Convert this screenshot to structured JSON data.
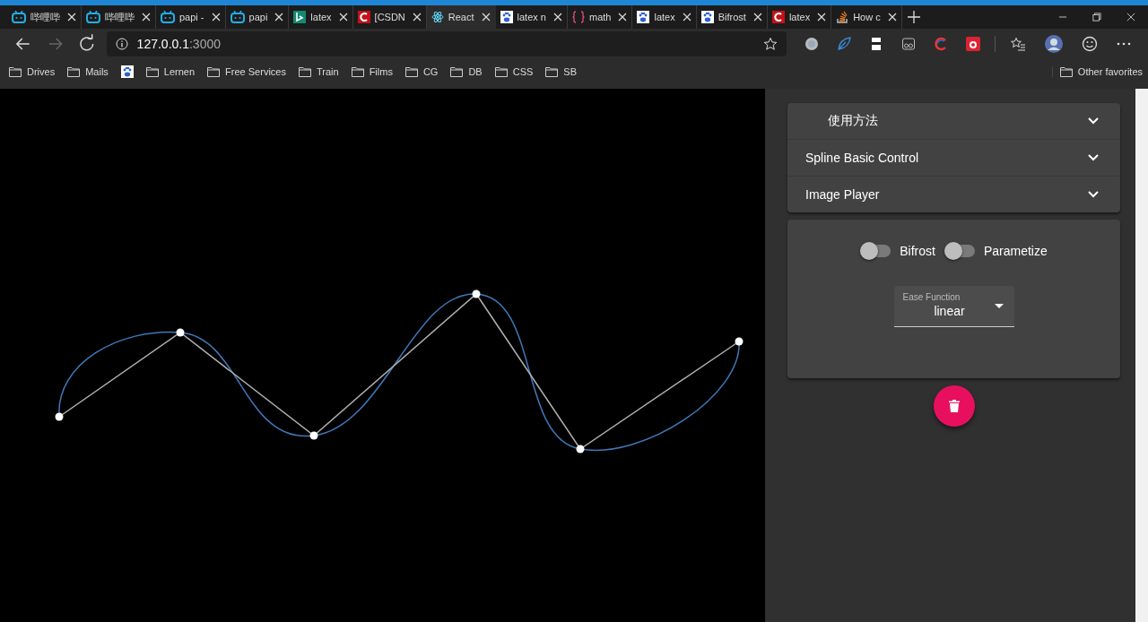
{
  "browser": {
    "tabs": [
      {
        "title": "哔哩哔",
        "kind": "bilibili",
        "selected": false
      },
      {
        "title": "哔哩哔",
        "kind": "bilibili",
        "selected": false
      },
      {
        "title": "papi -",
        "kind": "bilibili",
        "selected": false
      },
      {
        "title": "papi",
        "kind": "bilibili",
        "selected": false
      },
      {
        "title": "latex",
        "kind": "bing",
        "selected": false
      },
      {
        "title": "[CSDN",
        "kind": "csdn",
        "selected": false
      },
      {
        "title": "React",
        "kind": "react",
        "selected": true
      },
      {
        "title": "latex n",
        "kind": "baidu",
        "selected": false
      },
      {
        "title": "math",
        "kind": "braces",
        "selected": false
      },
      {
        "title": "latex",
        "kind": "baidu",
        "selected": false
      },
      {
        "title": "Bifrost",
        "kind": "baidu",
        "selected": false
      },
      {
        "title": "latex",
        "kind": "csdn",
        "selected": false
      },
      {
        "title": "How c",
        "kind": "stack",
        "selected": false
      }
    ],
    "address": {
      "host": "127.0.0.1",
      "rest": ":3000"
    },
    "forward_disabled": true,
    "bookmarks": [
      {
        "label": "Drives",
        "kind": "folder"
      },
      {
        "label": "Mails",
        "kind": "folder"
      },
      {
        "kind": "site"
      },
      {
        "label": "Lernen",
        "kind": "folder"
      },
      {
        "label": "Free Services",
        "kind": "folder"
      },
      {
        "label": "Train",
        "kind": "folder"
      },
      {
        "label": "Films",
        "kind": "folder"
      },
      {
        "label": "CG",
        "kind": "folder"
      },
      {
        "label": "DB",
        "kind": "folder"
      },
      {
        "label": "CSS",
        "kind": "folder"
      },
      {
        "label": "SB",
        "kind": "folder"
      }
    ],
    "other_favorites": "Other favorites"
  },
  "panel": {
    "accordions": [
      {
        "title": "使用方法",
        "expanded": false
      },
      {
        "title": "Spline Basic Control",
        "expanded": false
      },
      {
        "title": "Image Player",
        "expanded": false
      }
    ],
    "toggles": [
      {
        "label": "Bifrost",
        "on": false
      },
      {
        "label": "Parametize",
        "on": false
      }
    ],
    "select": {
      "label": "Ease Function",
      "value": "linear"
    }
  }
}
